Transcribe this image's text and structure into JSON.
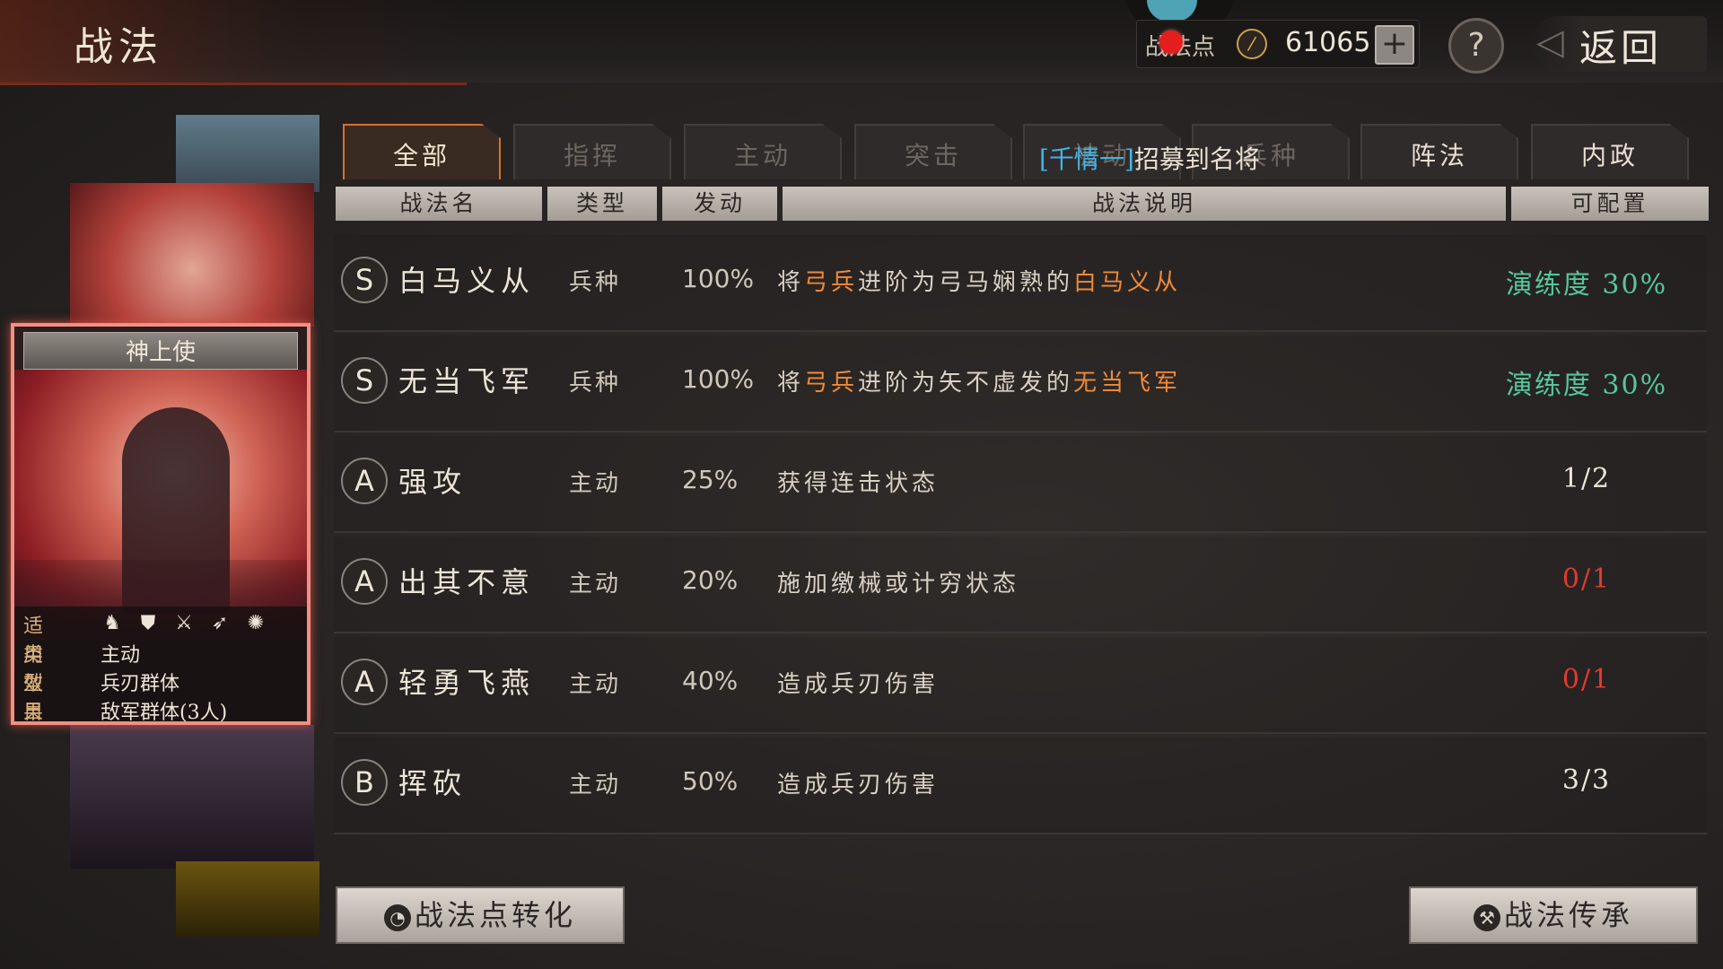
{
  "header": {
    "title": "战法",
    "currency_label": "战法点",
    "currency_value": "61065",
    "back_label": "返回"
  },
  "icons": {
    "currency": "fire-coin-icon",
    "add": "plus-icon",
    "help": "question-icon",
    "back": "back-arrow-icon"
  },
  "card": {
    "title": "神上使",
    "stats": [
      {
        "key": "适用",
        "value": ""
      },
      {
        "key": "类型",
        "value": "主动"
      },
      {
        "key": "效果",
        "value": "兵刃群体"
      },
      {
        "key": "目标",
        "value": "敌军群体(3人)"
      }
    ],
    "troop_icons": [
      "cavalry-icon",
      "shield-icon",
      "crossed-swords-icon",
      "archer-icon",
      "siege-icon"
    ]
  },
  "tabs": [
    {
      "label": "全部",
      "active": true
    },
    {
      "label": "指挥"
    },
    {
      "label": "主动"
    },
    {
      "label": "突击"
    },
    {
      "label": "被动"
    },
    {
      "label": "兵种"
    },
    {
      "label": "阵法"
    },
    {
      "label": "内政"
    }
  ],
  "tab_overlay": {
    "open": "[",
    "name": "千情一",
    "close": "]",
    "text": "招募到名将"
  },
  "columns": [
    "战法名",
    "类型",
    "发动",
    "战法说明",
    "可配置"
  ],
  "rows": [
    {
      "grade": "S",
      "name": "白马义从",
      "type": "兵种",
      "rate": "100%",
      "desc": [
        "将",
        "弓兵",
        "进阶为弓马娴熟的",
        "白马义从"
      ],
      "slot": "演练度 30%",
      "slot_color": "green"
    },
    {
      "grade": "S",
      "name": "无当飞军",
      "type": "兵种",
      "rate": "100%",
      "desc": [
        "将",
        "弓兵",
        "进阶为矢不虚发的",
        "无当飞军"
      ],
      "slot": "演练度 30%",
      "slot_color": "green"
    },
    {
      "grade": "A",
      "name": "强攻",
      "type": "主动",
      "rate": "25%",
      "desc": [
        "获得连击状态"
      ],
      "slot": "1/2",
      "slot_color": "white"
    },
    {
      "grade": "A",
      "name": "出其不意",
      "type": "主动",
      "rate": "20%",
      "desc": [
        "施加缴械或计穷状态"
      ],
      "slot": "0/1",
      "slot_color": "red"
    },
    {
      "grade": "A",
      "name": "轻勇飞燕",
      "type": "主动",
      "rate": "40%",
      "desc": [
        "造成兵刃伤害"
      ],
      "slot": "0/1",
      "slot_color": "red"
    },
    {
      "grade": "B",
      "name": "挥砍",
      "type": "主动",
      "rate": "50%",
      "desc": [
        "造成兵刃伤害"
      ],
      "slot": "3/3",
      "slot_color": "white"
    }
  ],
  "buttons": {
    "convert": "战法点转化",
    "inherit": "战法传承"
  },
  "colors": {
    "accent": "#d5722f",
    "highlight": "#f08a3a",
    "green": "#57c69a",
    "red": "#e23a2e",
    "card_border": "#f19082"
  }
}
